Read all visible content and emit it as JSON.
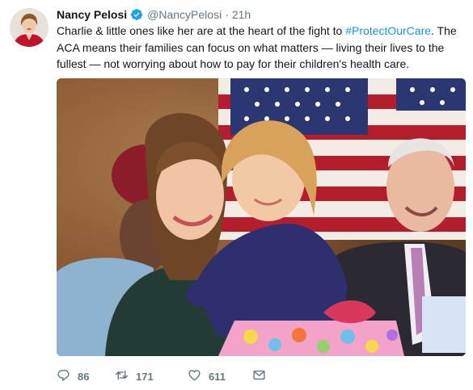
{
  "author": {
    "name": "Nancy Pelosi",
    "handle": "@NancyPelosi",
    "separator": "·",
    "time": "21h",
    "verified": true
  },
  "tweet": {
    "text_before": "Charlie & little ones like her are at the heart of the fight to ",
    "hashtag": "#ProtectOurCare",
    "text_after": ". The ACA means their families can focus on what matters — living their lives to the fullest — not worrying about how to pay for their children's health care."
  },
  "actions": {
    "replies": "86",
    "retweets": "171",
    "likes": "611"
  },
  "icons": {
    "reply": "reply-icon",
    "retweet": "retweet-icon",
    "like": "heart-icon",
    "dm": "envelope-icon",
    "verified": "verified-badge-icon"
  },
  "colors": {
    "text": "#14171a",
    "muted": "#657786",
    "link": "#1b95e0",
    "verified": "#1da1f2"
  }
}
